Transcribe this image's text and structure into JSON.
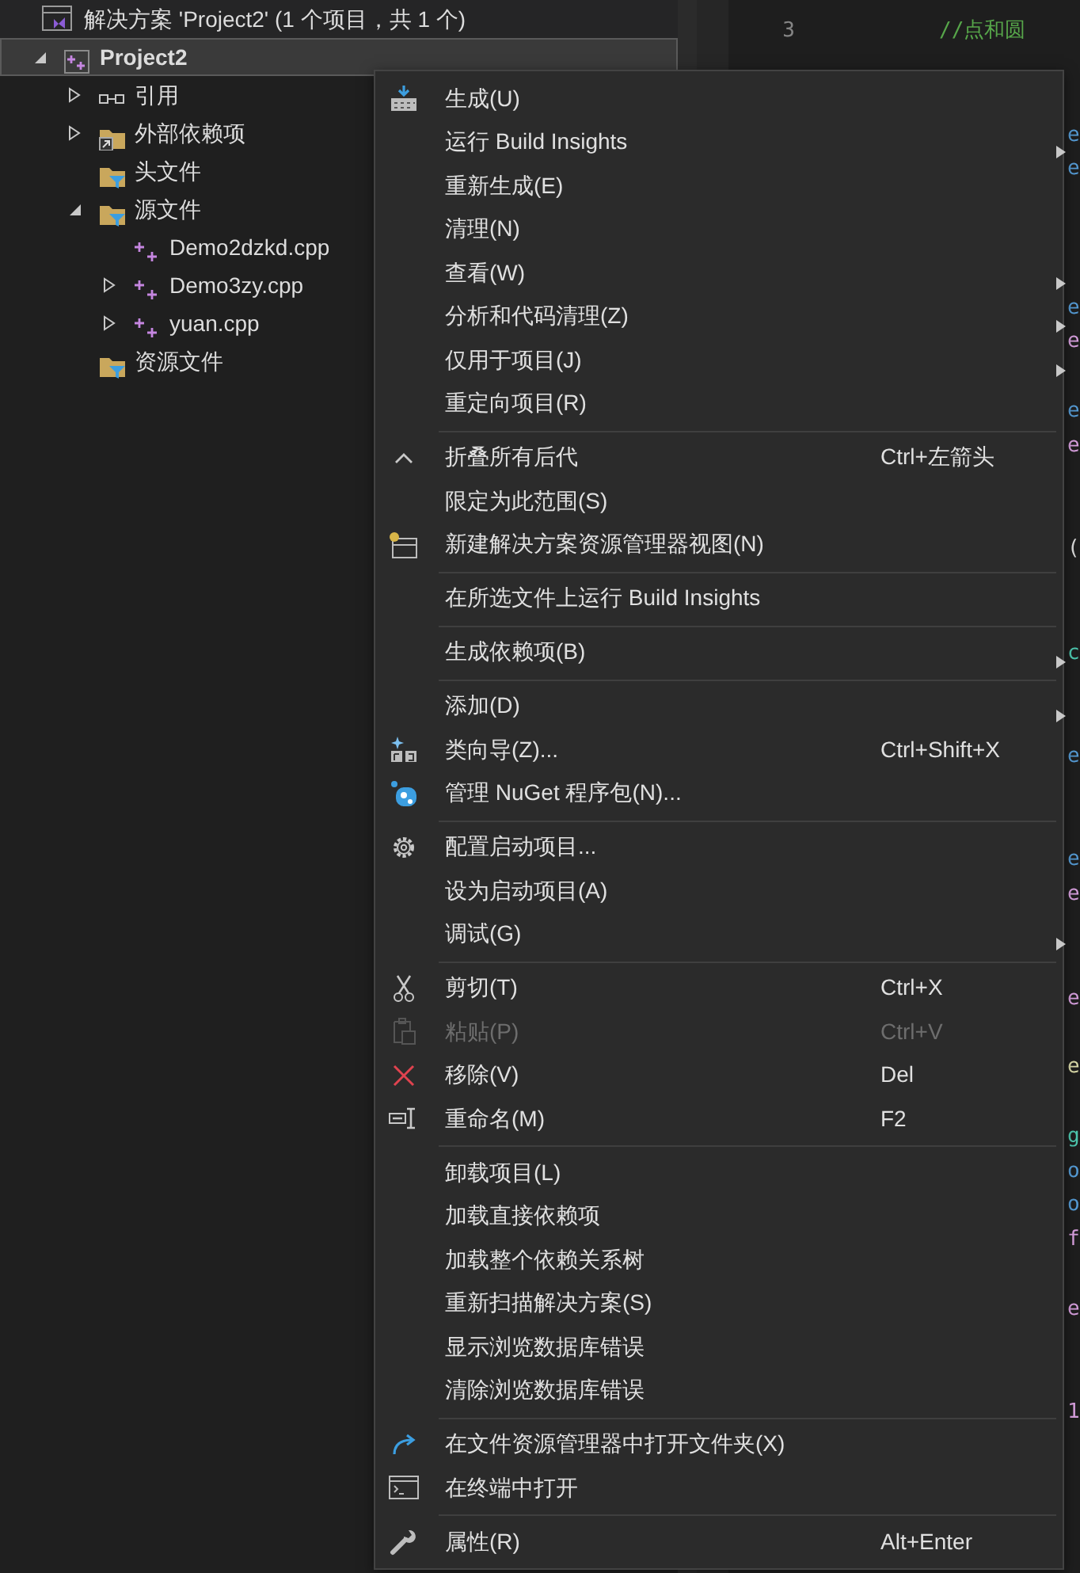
{
  "solution_explorer": {
    "solution": {
      "label": "解决方案 'Project2' (1 个项目，共 1 个)"
    },
    "tree": [
      {
        "label": "Project2",
        "kind": "project",
        "selected": true,
        "expanded": true,
        "children": [
          {
            "label": "引用",
            "kind": "references",
            "selected": false,
            "expanded": false
          },
          {
            "label": "外部依赖项",
            "kind": "external",
            "selected": false,
            "expanded": false
          },
          {
            "label": "头文件",
            "kind": "filter",
            "selected": false
          },
          {
            "label": "源文件",
            "kind": "filter",
            "selected": false,
            "expanded": true,
            "children": [
              {
                "label": "Demo2dzkd.cpp",
                "kind": "file",
                "selected": false
              },
              {
                "label": "Demo3zy.cpp",
                "kind": "file",
                "selected": false,
                "expanded": false
              },
              {
                "label": "yuan.cpp",
                "kind": "file",
                "selected": false,
                "expanded": false
              }
            ]
          },
          {
            "label": "资源文件",
            "kind": "filter",
            "selected": false
          }
        ]
      }
    ]
  },
  "editor": {
    "lines": [
      {
        "kind": "code",
        "number": "3",
        "text": "//点和圆",
        "color": "#57a64a"
      },
      {
        "kind": "blank"
      },
      {
        "kind": "blank"
      },
      {
        "kind": "edge",
        "text": "e",
        "color": "#569cd6"
      },
      {
        "kind": "edge",
        "text": "e",
        "color": "#569cd6"
      },
      {
        "kind": "blank"
      },
      {
        "kind": "blank"
      },
      {
        "kind": "blank"
      },
      {
        "kind": "edge",
        "text": "e",
        "color": "#569cd6"
      },
      {
        "kind": "edge",
        "text": "e",
        "color": "#d8a0df"
      },
      {
        "kind": "blank"
      },
      {
        "kind": "edge",
        "text": "e",
        "color": "#569cd6"
      },
      {
        "kind": "edge",
        "text": "e",
        "color": "#d8a0df"
      },
      {
        "kind": "blank"
      },
      {
        "kind": "blank"
      },
      {
        "kind": "edge",
        "text": "(",
        "color": "#dcdcdc"
      },
      {
        "kind": "blank"
      },
      {
        "kind": "blank"
      },
      {
        "kind": "edge",
        "text": "c",
        "color": "#4ec9b0"
      },
      {
        "kind": "blank"
      },
      {
        "kind": "blank"
      },
      {
        "kind": "edge",
        "text": "e",
        "color": "#569cd6"
      },
      {
        "kind": "blank"
      },
      {
        "kind": "blank"
      },
      {
        "kind": "edge",
        "text": "e",
        "color": "#569cd6"
      },
      {
        "kind": "edge",
        "text": "e",
        "color": "#d8a0df"
      },
      {
        "kind": "blank"
      },
      {
        "kind": "blank"
      },
      {
        "kind": "edge",
        "text": "e",
        "color": "#d8a0df"
      },
      {
        "kind": "blank"
      },
      {
        "kind": "edge",
        "text": "e",
        "color": "#dcdcaa"
      },
      {
        "kind": "blank"
      },
      {
        "kind": "edge",
        "text": "g",
        "color": "#4ec9b0"
      },
      {
        "kind": "edge",
        "text": "o",
        "color": "#569cd6"
      },
      {
        "kind": "edge",
        "text": "o",
        "color": "#569cd6"
      },
      {
        "kind": "edge",
        "text": "f",
        "color": "#d8a0df"
      },
      {
        "kind": "blank"
      },
      {
        "kind": "edge",
        "text": "e",
        "color": "#d8a0df"
      },
      {
        "kind": "blank"
      },
      {
        "kind": "blank"
      },
      {
        "kind": "edge",
        "text": "1",
        "color": "#d8a0df"
      }
    ]
  },
  "context_menu": {
    "items": [
      {
        "kind": "item",
        "label": "生成(U)",
        "disabled": false,
        "submenu": false
      },
      {
        "kind": "item",
        "label": "运行 Build Insights",
        "disabled": false,
        "submenu": true
      },
      {
        "kind": "item",
        "label": "重新生成(E)",
        "disabled": false,
        "submenu": false
      },
      {
        "kind": "item",
        "label": "清理(N)",
        "disabled": false,
        "submenu": false
      },
      {
        "kind": "item",
        "label": "查看(W)",
        "disabled": false,
        "submenu": true
      },
      {
        "kind": "item",
        "label": "分析和代码清理(Z)",
        "disabled": false,
        "submenu": true
      },
      {
        "kind": "item",
        "label": "仅用于项目(J)",
        "disabled": false,
        "submenu": true
      },
      {
        "kind": "item",
        "label": "重定向项目(R)",
        "disabled": false,
        "submenu": false
      },
      {
        "kind": "separator"
      },
      {
        "kind": "item",
        "label": "折叠所有后代",
        "shortcut": "Ctrl+左箭头",
        "disabled": false,
        "submenu": false
      },
      {
        "kind": "item",
        "label": "限定为此范围(S)",
        "disabled": false,
        "submenu": false
      },
      {
        "kind": "item",
        "label": "新建解决方案资源管理器视图(N)",
        "disabled": false,
        "submenu": false
      },
      {
        "kind": "separator"
      },
      {
        "kind": "item",
        "label": "在所选文件上运行 Build Insights",
        "disabled": false,
        "submenu": false
      },
      {
        "kind": "separator"
      },
      {
        "kind": "item",
        "label": "生成依赖项(B)",
        "disabled": false,
        "submenu": true
      },
      {
        "kind": "separator"
      },
      {
        "kind": "item",
        "label": "添加(D)",
        "disabled": false,
        "submenu": true
      },
      {
        "kind": "item",
        "label": "类向导(Z)...",
        "shortcut": "Ctrl+Shift+X",
        "disabled": false,
        "submenu": false
      },
      {
        "kind": "item",
        "label": "管理 NuGet 程序包(N)...",
        "disabled": false,
        "submenu": false
      },
      {
        "kind": "separator"
      },
      {
        "kind": "item",
        "label": "配置启动项目...",
        "disabled": false,
        "submenu": false
      },
      {
        "kind": "item",
        "label": "设为启动项目(A)",
        "disabled": false,
        "submenu": false
      },
      {
        "kind": "item",
        "label": "调试(G)",
        "disabled": false,
        "submenu": true
      },
      {
        "kind": "separator"
      },
      {
        "kind": "item",
        "label": "剪切(T)",
        "shortcut": "Ctrl+X",
        "disabled": false,
        "submenu": false
      },
      {
        "kind": "item",
        "label": "粘贴(P)",
        "shortcut": "Ctrl+V",
        "disabled": true,
        "submenu": false
      },
      {
        "kind": "item",
        "label": "移除(V)",
        "shortcut": "Del",
        "disabled": false,
        "submenu": false
      },
      {
        "kind": "item",
        "label": "重命名(M)",
        "shortcut": "F2",
        "disabled": false,
        "submenu": false
      },
      {
        "kind": "separator"
      },
      {
        "kind": "item",
        "label": "卸载项目(L)",
        "disabled": false,
        "submenu": false
      },
      {
        "kind": "item",
        "label": "加载直接依赖项",
        "disabled": false,
        "submenu": false
      },
      {
        "kind": "item",
        "label": "加载整个依赖关系树",
        "disabled": false,
        "submenu": false
      },
      {
        "kind": "item",
        "label": "重新扫描解决方案(S)",
        "disabled": false,
        "submenu": false
      },
      {
        "kind": "item",
        "label": "显示浏览数据库错误",
        "disabled": false,
        "submenu": false
      },
      {
        "kind": "item",
        "label": "清除浏览数据库错误",
        "disabled": false,
        "submenu": false
      },
      {
        "kind": "separator"
      },
      {
        "kind": "item",
        "label": "在文件资源管理器中打开文件夹(X)",
        "disabled": false,
        "submenu": false
      },
      {
        "kind": "item",
        "label": "在终端中打开",
        "disabled": false,
        "submenu": false
      },
      {
        "kind": "separator"
      },
      {
        "kind": "item",
        "label": "属性(R)",
        "shortcut": "Alt+Enter",
        "disabled": false,
        "submenu": false
      }
    ]
  }
}
